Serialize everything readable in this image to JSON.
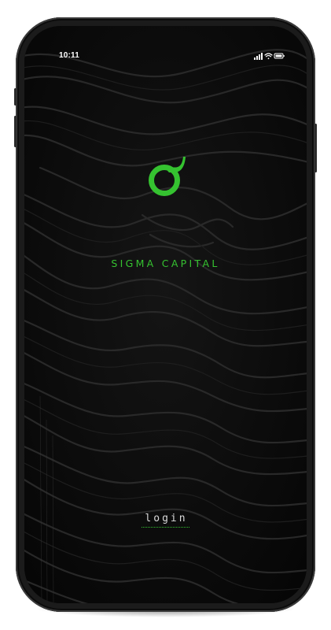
{
  "status_bar": {
    "time": "10:11",
    "icons": [
      "signal-icon",
      "wifi-icon",
      "battery-icon"
    ]
  },
  "app": {
    "logo_glyph": "σ",
    "brand_name": "SIGMA CAPITAL",
    "login_label": "login"
  },
  "colors": {
    "accent": "#35c230",
    "background": "#0a0a0a",
    "text": "#d9d9d9"
  }
}
